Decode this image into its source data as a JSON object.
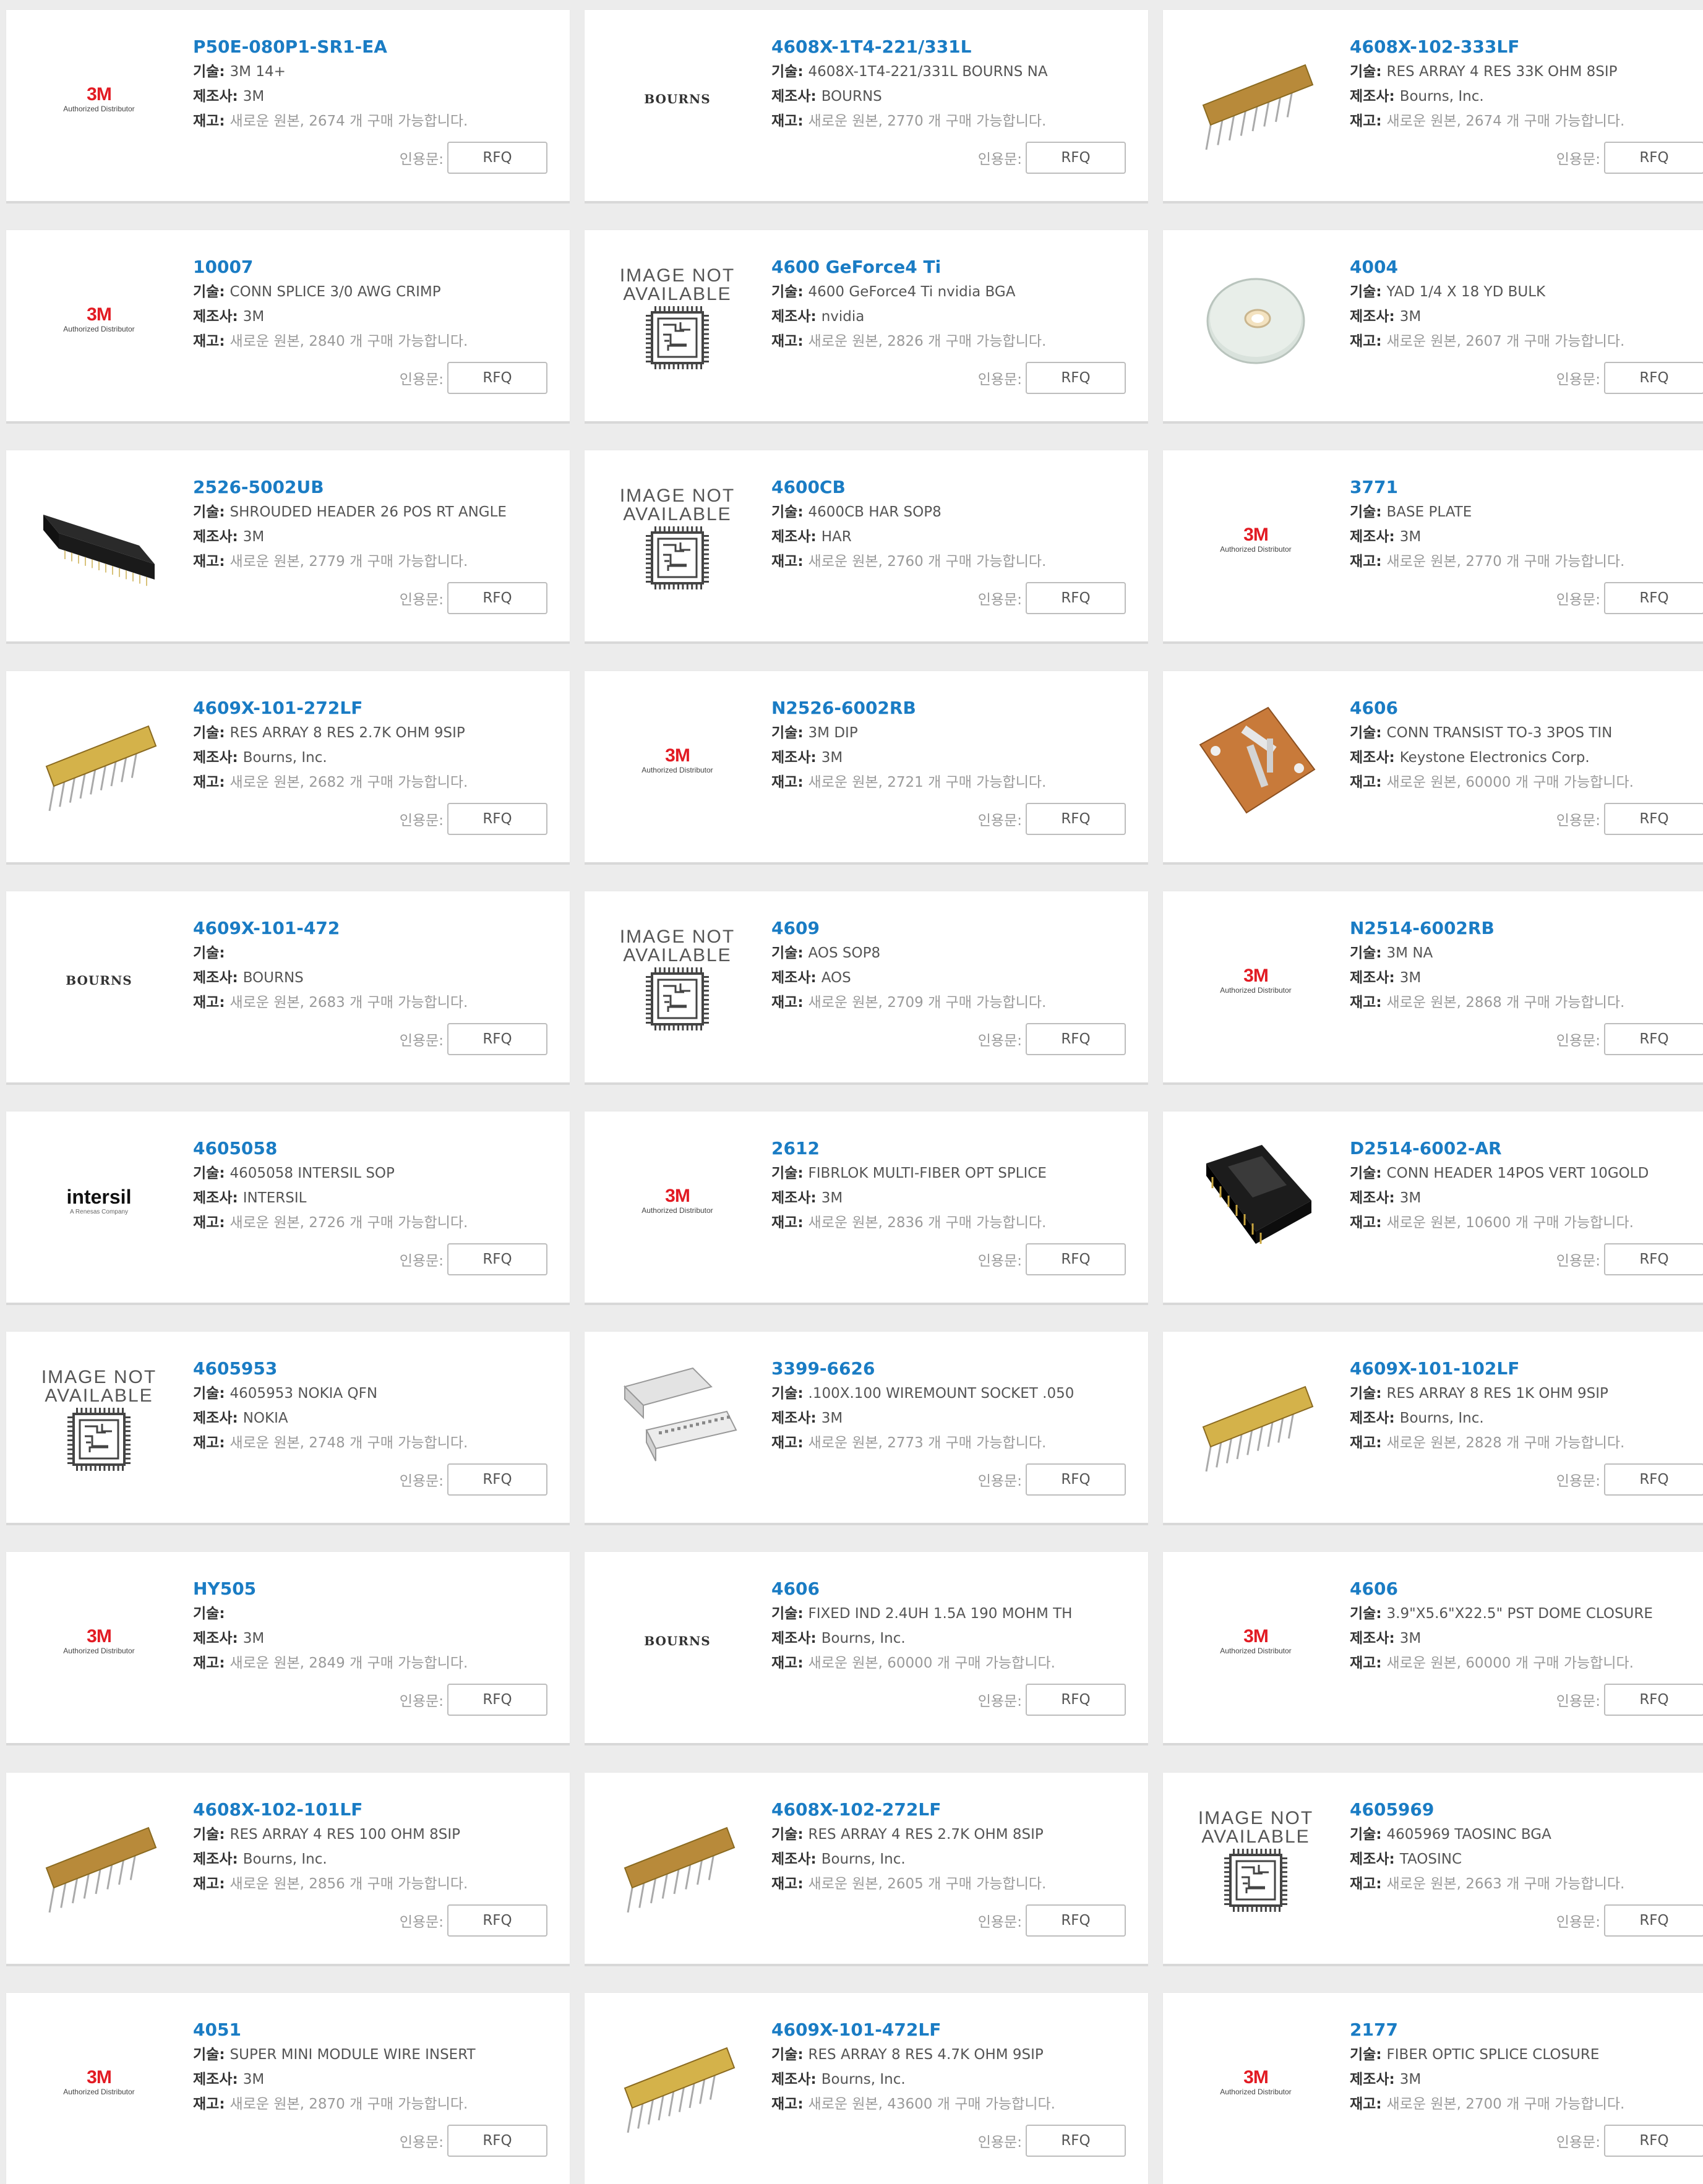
{
  "labels": {
    "tech": "기술:",
    "mfr": "제조사:",
    "stock": "재고:",
    "quote": "인용문:",
    "rfq": "RFQ"
  },
  "image_not_available": [
    "IMAGE NOT",
    "AVAILABLE"
  ],
  "logos": {
    "3m": {
      "mark": "3M",
      "sub": "Authorized Distributor"
    },
    "bourns": {
      "mark": "BOURNS"
    },
    "intersil": {
      "mark": "intersil",
      "sub": "A Renesas Company"
    }
  },
  "colors": {
    "link": "#1a7cc4",
    "brand_3m": "#e21b23",
    "resistor": "#d4b24a"
  },
  "products": [
    {
      "pn": "P50E-080P1-SR1-EA",
      "tech": "3M 14+",
      "mfr": "3M",
      "stock": "새로운 원본, 2674 개 구매 가능합니다.",
      "img": "3m"
    },
    {
      "pn": "4608X-1T4-221/331L",
      "tech": "4608X-1T4-221/331L BOURNS NA",
      "mfr": "BOURNS",
      "stock": "새로운 원본, 2770 개 구매 가능합니다.",
      "img": "bourns"
    },
    {
      "pn": "4608X-102-333LF",
      "tech": "RES ARRAY 4 RES 33K OHM 8SIP",
      "mfr": "Bourns, Inc.",
      "stock": "새로운 원본, 2674 개 구매 가능합니다.",
      "img": "sip-brown"
    },
    {
      "pn": "10007",
      "tech": "CONN SPLICE 3/0 AWG CRIMP",
      "mfr": "3M",
      "stock": "새로운 원본, 2840 개 구매 가능합니다.",
      "img": "3m"
    },
    {
      "pn": "4600 GeForce4 Ti",
      "tech": "4600 GeForce4 Ti nvidia BGA",
      "mfr": "nvidia",
      "stock": "새로운 원본, 2826 개 구매 가능합니다.",
      "img": "na"
    },
    {
      "pn": "4004",
      "tech": "YAD 1/4 X 18 YD BULK",
      "mfr": "3M",
      "stock": "새로운 원본, 2607 개 구매 가능합니다.",
      "img": "tape"
    },
    {
      "pn": "2526-5002UB",
      "tech": "SHROUDED HEADER 26 POS RT ANGLE",
      "mfr": "3M",
      "stock": "새로운 원본, 2779 개 구매 가능합니다.",
      "img": "header-rt"
    },
    {
      "pn": "4600CB",
      "tech": "4600CB HAR SOP8",
      "mfr": "HAR",
      "stock": "새로운 원본, 2760 개 구매 가능합니다.",
      "img": "na"
    },
    {
      "pn": "3771",
      "tech": "BASE PLATE",
      "mfr": "3M",
      "stock": "새로운 원본, 2770 개 구매 가능합니다.",
      "img": "3m"
    },
    {
      "pn": "4609X-101-272LF",
      "tech": "RES ARRAY 8 RES 2.7K OHM 9SIP",
      "mfr": "Bourns, Inc.",
      "stock": "새로운 원본, 2682 개 구매 가능합니다.",
      "img": "sip-yellow"
    },
    {
      "pn": "N2526-6002RB",
      "tech": "3M DIP",
      "mfr": "3M",
      "stock": "새로운 원본, 2721 개 구매 가능합니다.",
      "img": "3m"
    },
    {
      "pn": "4606",
      "tech": "CONN TRANSIST TO-3 3POS TIN",
      "mfr": "Keystone Electronics Corp.",
      "stock": "새로운 원본, 60000 개 구매 가능합니다.",
      "img": "to3"
    },
    {
      "pn": "4609X-101-472",
      "tech": "",
      "mfr": "BOURNS",
      "stock": "새로운 원본, 2683 개 구매 가능합니다.",
      "img": "bourns"
    },
    {
      "pn": "4609",
      "tech": "AOS SOP8",
      "mfr": "AOS",
      "stock": "새로운 원본, 2709 개 구매 가능합니다.",
      "img": "na"
    },
    {
      "pn": "N2514-6002RB",
      "tech": "3M NA",
      "mfr": "3M",
      "stock": "새로운 원본, 2868 개 구매 가능합니다.",
      "img": "3m"
    },
    {
      "pn": "4605058",
      "tech": "4605058 INTERSIL SOP",
      "mfr": "INTERSIL",
      "stock": "새로운 원본, 2726 개 구매 가능합니다.",
      "img": "intersil"
    },
    {
      "pn": "2612",
      "tech": "FIBRLOK MULTI-FIBER OPT SPLICE",
      "mfr": "3M",
      "stock": "새로운 원본, 2836 개 구매 가능합니다.",
      "img": "3m"
    },
    {
      "pn": "D2514-6002-AR",
      "tech": "CONN HEADER 14POS VERT 10GOLD",
      "mfr": "3M",
      "stock": "새로운 원본, 10600 개 구매 가능합니다.",
      "img": "header-vert"
    },
    {
      "pn": "4605953",
      "tech": "4605953 NOKIA QFN",
      "mfr": "NOKIA",
      "stock": "새로운 원본, 2748 개 구매 가능합니다.",
      "img": "na"
    },
    {
      "pn": "3399-6626",
      "tech": ".100X.100 WIREMOUNT SOCKET .050",
      "mfr": "3M",
      "stock": "새로운 원본, 2773 개 구매 가능합니다.",
      "img": "socket"
    },
    {
      "pn": "4609X-101-102LF",
      "tech": "RES ARRAY 8 RES 1K OHM 9SIP",
      "mfr": "Bourns, Inc.",
      "stock": "새로운 원본, 2828 개 구매 가능합니다.",
      "img": "sip-yellow"
    },
    {
      "pn": "HY505",
      "tech": "",
      "mfr": "3M",
      "stock": "새로운 원본, 2849 개 구매 가능합니다.",
      "img": "3m"
    },
    {
      "pn": "4606",
      "tech": "FIXED IND 2.4UH 1.5A 190 MOHM TH",
      "mfr": "Bourns, Inc.",
      "stock": "새로운 원본, 60000 개 구매 가능합니다.",
      "img": "bourns"
    },
    {
      "pn": "4606",
      "tech": "3.9\"X5.6\"X22.5\" PST DOME CLOSURE",
      "mfr": "3M",
      "stock": "새로운 원본, 60000 개 구매 가능합니다.",
      "img": "3m"
    },
    {
      "pn": "4608X-102-101LF",
      "tech": "RES ARRAY 4 RES 100 OHM 8SIP",
      "mfr": "Bourns, Inc.",
      "stock": "새로운 원본, 2856 개 구매 가능합니다.",
      "img": "sip-brown"
    },
    {
      "pn": "4608X-102-272LF",
      "tech": "RES ARRAY 4 RES 2.7K OHM 8SIP",
      "mfr": "Bourns, Inc.",
      "stock": "새로운 원본, 2605 개 구매 가능합니다.",
      "img": "sip-brown"
    },
    {
      "pn": "4605969",
      "tech": "4605969 TAOSINC BGA",
      "mfr": "TAOSINC",
      "stock": "새로운 원본, 2663 개 구매 가능합니다.",
      "img": "na"
    },
    {
      "pn": "4051",
      "tech": "SUPER MINI MODULE WIRE INSERT",
      "mfr": "3M",
      "stock": "새로운 원본, 2870 개 구매 가능합니다.",
      "img": "3m"
    },
    {
      "pn": "4609X-101-472LF",
      "tech": "RES ARRAY 8 RES 4.7K OHM 9SIP",
      "mfr": "Bourns, Inc.",
      "stock": "새로운 원본, 43600 개 구매 가능합니다.",
      "img": "sip-yellow"
    },
    {
      "pn": "2177",
      "tech": "FIBER OPTIC SPLICE CLOSURE",
      "mfr": "3M",
      "stock": "새로운 원본, 2700 개 구매 가능합니다.",
      "img": "3m"
    }
  ]
}
